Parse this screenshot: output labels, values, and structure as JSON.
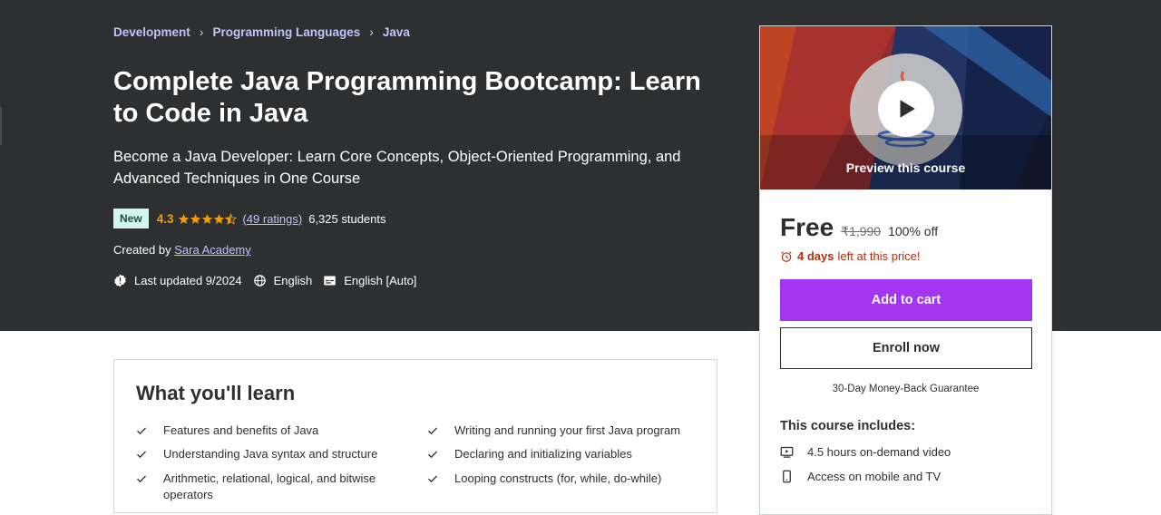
{
  "breadcrumb": [
    "Development",
    "Programming Languages",
    "Java"
  ],
  "course": {
    "title": "Complete Java Programming Bootcamp: Learn to Code in Java",
    "subtitle": "Become a Java Developer: Learn Core Concepts, Object-Oriented Programming, and Advanced Techniques in One Course",
    "badge": "New",
    "rating": "4.3",
    "rating_value": 4.3,
    "ratings_link": "(49 ratings)",
    "students": "6,325 students",
    "created_by_label": "Created by",
    "author": "Sara Academy",
    "last_updated": "Last updated 9/2024",
    "language": "English",
    "captions": "English [Auto]"
  },
  "card": {
    "preview_label": "Preview this course",
    "price_now": "Free",
    "price_old": "₹1,990",
    "discount": "100% off",
    "timer_days": "4 days",
    "timer_rest": "left at this price!",
    "add_to_cart": "Add to cart",
    "enroll_now": "Enroll now",
    "guarantee": "30-Day Money-Back Guarantee",
    "includes_title": "This course includes:",
    "includes": [
      {
        "icon": "video-icon",
        "label": "4.5 hours on-demand video"
      },
      {
        "icon": "mobile-icon",
        "label": "Access on mobile and TV"
      }
    ]
  },
  "learn": {
    "title": "What you'll learn",
    "items": [
      "Features and benefits of Java",
      "Writing and running your first Java program",
      "Understanding Java syntax and structure",
      "Declaring and initializing variables",
      "Arithmetic, relational, logical, and bitwise operators",
      "Looping constructs (for, while, do-while)"
    ]
  },
  "colors": {
    "hero_bg": "#2d2f31",
    "link": "#c0c4fc",
    "rating": "#f69c08",
    "cta_purple": "#a435f0",
    "timer_red": "#b32d0f",
    "badge_bg": "#d2f5ec"
  }
}
